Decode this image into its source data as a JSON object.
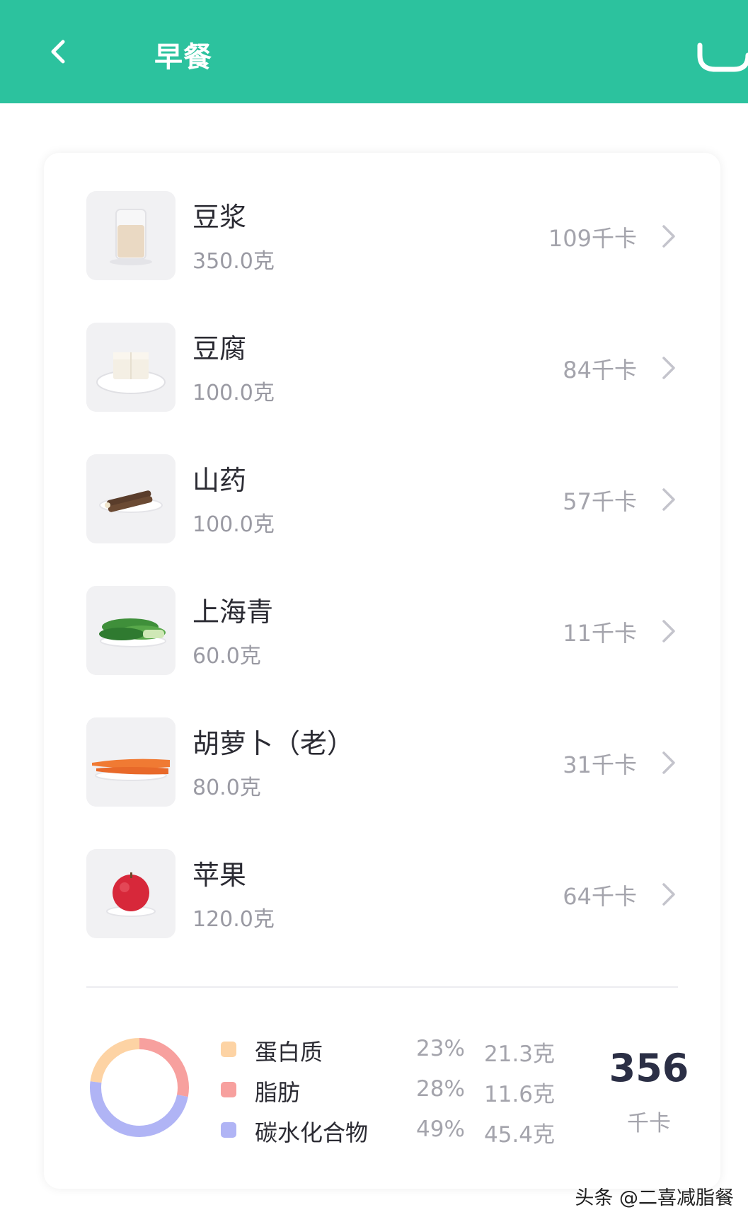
{
  "header": {
    "title": "早餐",
    "background": "#2cc29e",
    "back_icon": "back-arrow-icon",
    "right_icon": "edit-icon"
  },
  "foods": [
    {
      "name": "豆浆",
      "weight": "350.0克",
      "kcal": "109千卡",
      "icon": "soy-milk-image"
    },
    {
      "name": "豆腐",
      "weight": "100.0克",
      "kcal": "84千卡",
      "icon": "tofu-image"
    },
    {
      "name": "山药",
      "weight": "100.0克",
      "kcal": "57千卡",
      "icon": "yam-image"
    },
    {
      "name": "上海青",
      "weight": "60.0克",
      "kcal": "11千卡",
      "icon": "bok-choy-image"
    },
    {
      "name": "胡萝卜（老）",
      "weight": "80.0克",
      "kcal": "31千卡",
      "icon": "carrot-image"
    },
    {
      "name": "苹果",
      "weight": "120.0克",
      "kcal": "64千卡",
      "icon": "apple-image"
    }
  ],
  "nutrition": {
    "items": [
      {
        "name": "蛋白质",
        "percent": "23%",
        "grams": "21.3克",
        "color": "#fdd3a4"
      },
      {
        "name": "脂肪",
        "percent": "28%",
        "grams": "11.6克",
        "color": "#f7a09e"
      },
      {
        "name": "碳水化合物",
        "percent": "49%",
        "grams": "45.4克",
        "color": "#b0b4f5"
      }
    ],
    "shares": [
      23,
      28,
      49
    ]
  },
  "total": {
    "value": "356",
    "unit": "千卡"
  },
  "watermark": "头条 @二喜减脂餐"
}
